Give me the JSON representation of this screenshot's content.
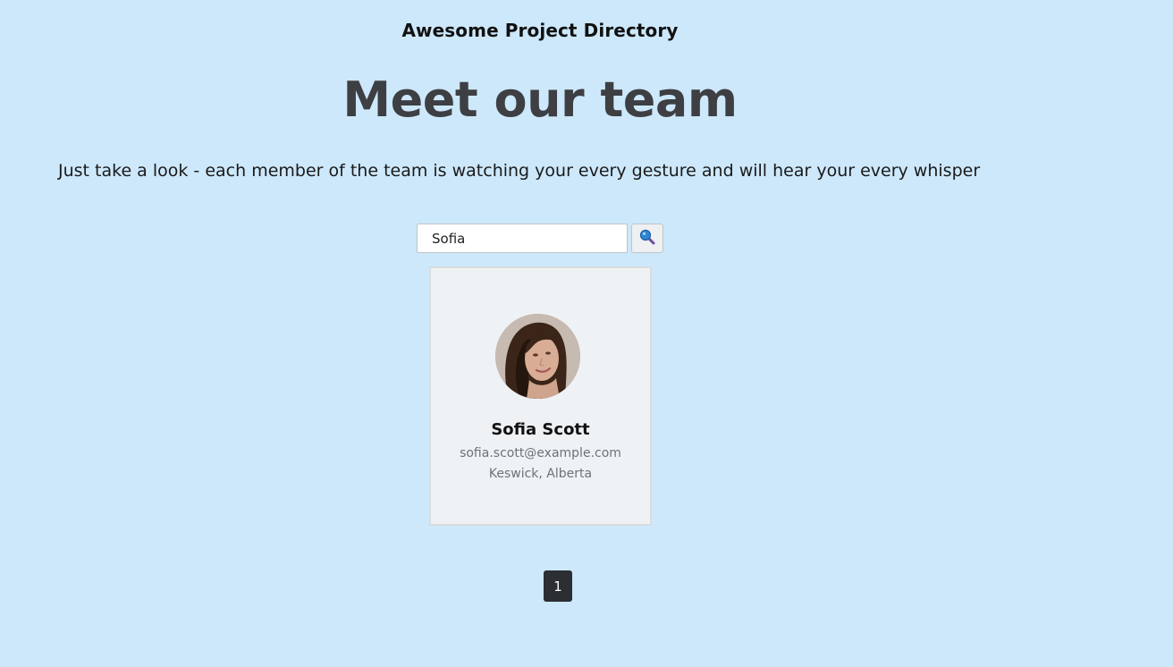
{
  "header": {
    "app_title": "Awesome Project Directory",
    "headline": "Meet our team",
    "tagline": "Just take a look - each member of the team is watching your every gesture and will hear your every whisper"
  },
  "search": {
    "value": "Sofia",
    "button_icon": "search-icon"
  },
  "members": [
    {
      "name": "Sofia Scott",
      "email": "sofia.scott@example.com",
      "location": "Keswick, Alberta",
      "avatar_icon": "avatar-photo"
    }
  ],
  "pagination": {
    "pages": [
      "1"
    ],
    "current": "1"
  },
  "colors": {
    "background": "#cde8fb",
    "card": "#eff2f5",
    "headline": "#3d3f43",
    "page_button": "#2b2e33"
  }
}
